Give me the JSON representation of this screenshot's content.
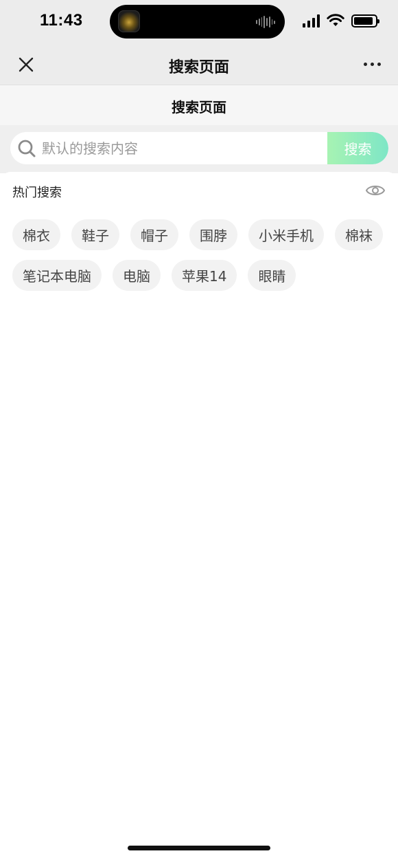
{
  "status_bar": {
    "time": "11:43",
    "icons": [
      "signal-icon",
      "wifi-icon",
      "battery-icon"
    ],
    "battery_level": 0.9
  },
  "nav": {
    "title": "搜索页面",
    "close_icon": "close-icon",
    "more_icon": "more-icon"
  },
  "page_header": {
    "title": "搜索页面"
  },
  "search": {
    "placeholder": "默认的搜索内容",
    "button_label": "搜索",
    "icon": "search-icon",
    "accent_gradient": [
      "#a7f3b3",
      "#7ee6c6"
    ]
  },
  "hot_search": {
    "title": "热门搜索",
    "toggle_icon": "eye-icon",
    "tags": [
      "棉衣",
      "鞋子",
      "帽子",
      "围脖",
      "小米手机",
      "棉袜",
      "笔记本电脑",
      "电脑",
      "苹果14",
      "眼睛"
    ]
  }
}
